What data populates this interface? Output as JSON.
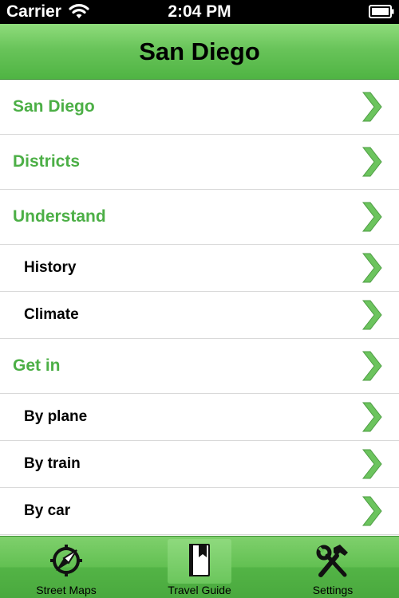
{
  "status_bar": {
    "carrier": "Carrier",
    "time": "2:04 PM",
    "wifi_icon": "wifi-icon",
    "battery_icon": "battery-icon"
  },
  "nav": {
    "title": "San Diego"
  },
  "list": {
    "items": [
      {
        "label": "San Diego",
        "level": "section",
        "chevron_icon": "chevron-right-icon"
      },
      {
        "label": "Districts",
        "level": "section",
        "chevron_icon": "chevron-right-icon"
      },
      {
        "label": "Understand",
        "level": "section",
        "chevron_icon": "chevron-right-icon"
      },
      {
        "label": "History",
        "level": "sub",
        "chevron_icon": "chevron-right-icon"
      },
      {
        "label": "Climate",
        "level": "sub",
        "chevron_icon": "chevron-right-icon"
      },
      {
        "label": "Get in",
        "level": "section",
        "chevron_icon": "chevron-right-icon"
      },
      {
        "label": "By plane",
        "level": "sub",
        "chevron_icon": "chevron-right-icon"
      },
      {
        "label": "By train",
        "level": "sub",
        "chevron_icon": "chevron-right-icon"
      },
      {
        "label": "By car",
        "level": "sub",
        "chevron_icon": "chevron-right-icon"
      }
    ]
  },
  "tab_bar": {
    "tabs": [
      {
        "label": "Street Maps",
        "icon": "compass-icon",
        "selected": false
      },
      {
        "label": "Travel Guide",
        "icon": "book-icon",
        "selected": true
      },
      {
        "label": "Settings",
        "icon": "tools-icon",
        "selected": false
      }
    ]
  },
  "colors": {
    "accent_green": "#4caf46",
    "nav_green": "#69c45a",
    "chevron_green": "#6cc45e",
    "divider": "#d9d9d9"
  }
}
